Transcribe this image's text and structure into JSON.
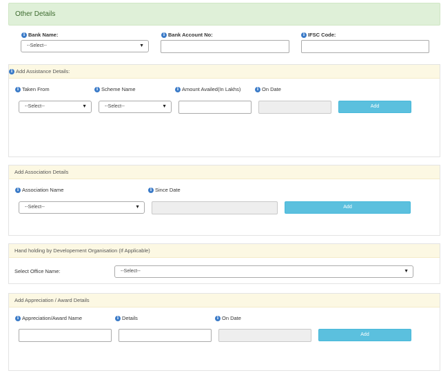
{
  "other_details": {
    "title": "Other Details",
    "bank_name_label": "Bank Name:",
    "bank_name_value": "--Select--",
    "bank_account_label": "Bank Account No:",
    "ifsc_label": "IFSC Code:"
  },
  "assistance": {
    "title": "Add Assistance Details:",
    "taken_from_label": "Taken From",
    "scheme_name_label": "Scheme Name",
    "amount_label": "Amount Availed(In Lakhs)",
    "on_date_label": "On Date",
    "taken_from_value": "--Select--",
    "scheme_name_value": "--Select--",
    "add_button": "Add"
  },
  "association": {
    "title": "Add Association Details",
    "name_label": "Association Name",
    "since_label": "Since Date",
    "name_value": "--Select--",
    "add_button": "Add"
  },
  "hand_holding": {
    "title": "Hand holding by Developement Organisation (If Applicable)",
    "office_label": "Select Office Name:",
    "office_value": "--Select--"
  },
  "appreciation": {
    "title": "Add Appreciation / Award Details",
    "name_label": "Appreciation/Award Name",
    "details_label": "Details",
    "on_date_label": "On Date",
    "add_button": "Add"
  },
  "icons": {
    "info": "info-icon",
    "dropdown": "chevron-down-icon"
  },
  "colors": {
    "header_green": "#dff0d8",
    "panel_head": "#fcf8e3",
    "button": "#5bc0de",
    "info_icon": "#3b7bc8"
  }
}
